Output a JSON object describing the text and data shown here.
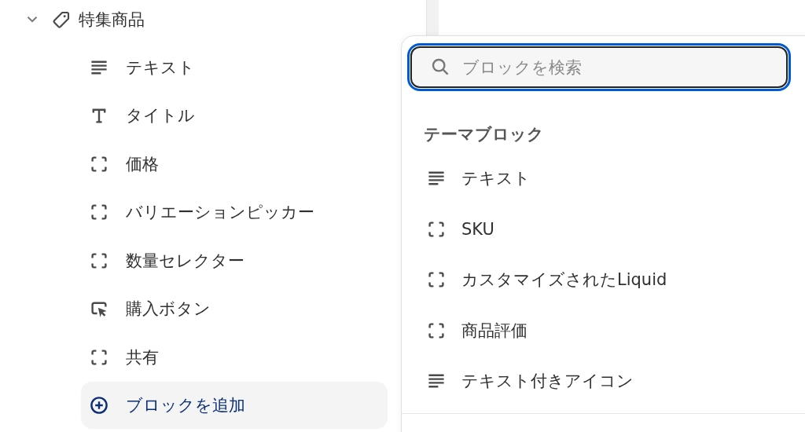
{
  "section": {
    "title": "特集商品",
    "expanded": true,
    "children": [
      {
        "kind": "text",
        "label": "テキスト"
      },
      {
        "kind": "title",
        "label": "タイトル"
      },
      {
        "kind": "block",
        "label": "価格"
      },
      {
        "kind": "block",
        "label": "バリエーションピッカー"
      },
      {
        "kind": "block",
        "label": "数量セレクター"
      },
      {
        "kind": "button",
        "label": "購入ボタン"
      },
      {
        "kind": "block",
        "label": "共有"
      }
    ],
    "add_button": "ブロックを追加"
  },
  "popover": {
    "search": {
      "placeholder": "ブロックを検索"
    },
    "heading": "テーマブロック",
    "items": [
      {
        "kind": "text",
        "label": "テキスト"
      },
      {
        "kind": "block",
        "label": "SKU"
      },
      {
        "kind": "block",
        "label": "カスタマイズされたLiquid"
      },
      {
        "kind": "block",
        "label": "商品評価"
      },
      {
        "kind": "text",
        "label": "テキスト付きアイコン"
      }
    ]
  }
}
